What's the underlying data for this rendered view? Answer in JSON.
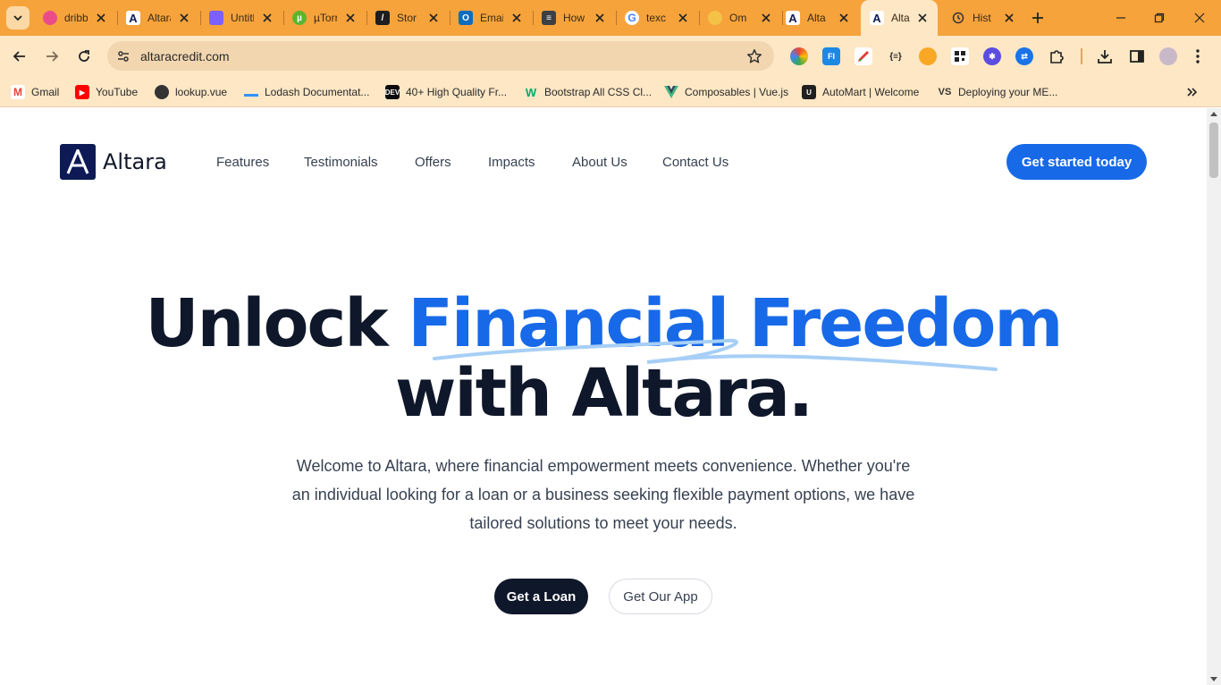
{
  "browser": {
    "tabs": [
      {
        "label": "dribbble",
        "icon": "dribbble-icon",
        "color": "#ea4c89"
      },
      {
        "label": "Altara",
        "icon": "altara-icon",
        "color": "#0d1a56"
      },
      {
        "label": "Untitled",
        "icon": "calendar-icon",
        "color": "#7b61ff"
      },
      {
        "label": "µTorrent",
        "icon": "utorrent-icon",
        "color": "#5eb42c"
      },
      {
        "label": "Stor",
        "icon": "storybook-icon",
        "color": "#1e1e1e"
      },
      {
        "label": "Email",
        "icon": "outlook-icon",
        "color": "#0f6cbd"
      },
      {
        "label": "How",
        "icon": "doc-icon",
        "color": "#3c4043"
      },
      {
        "label": "texc",
        "icon": "google-icon",
        "color": "#4285f4"
      },
      {
        "label": "Om",
        "icon": "om-icon",
        "color": "#f3c246"
      },
      {
        "label": "Alta",
        "icon": "altara-icon",
        "color": "#0d1a56"
      },
      {
        "label": "Alta",
        "icon": "altara-icon",
        "color": "#0d1a56"
      },
      {
        "label": "Hist",
        "icon": "history-icon",
        "color": "#3c3c3c"
      }
    ],
    "url": "altaracredit.com",
    "bookmarks": [
      {
        "label": "Gmail",
        "icon": "gmail-icon",
        "color": "#ea4335"
      },
      {
        "label": "YouTube",
        "icon": "youtube-icon",
        "color": "#ff0000"
      },
      {
        "label": "lookup.vue",
        "icon": "globe-icon",
        "color": "#333333"
      },
      {
        "label": "Lodash Documentat...",
        "icon": "lodash-icon",
        "color": "#3492ff"
      },
      {
        "label": "40+ High Quality Fr...",
        "icon": "dev-icon",
        "color": "#0a0a0a"
      },
      {
        "label": "Bootstrap All CSS Cl...",
        "icon": "w3-icon",
        "color": "#04aa6d"
      },
      {
        "label": "Composables | Vue.js",
        "icon": "vue-icon",
        "color": "#41b883"
      },
      {
        "label": "AutoMart | Welcome",
        "icon": "automart-icon",
        "color": "#1f1f1f"
      },
      {
        "label": "Deploying your ME...",
        "icon": "vs-icon",
        "color": "#333333"
      }
    ]
  },
  "site": {
    "logo_text": "Altara",
    "logo_letter": "A",
    "nav": [
      "Features",
      "Testimonials",
      "Offers",
      "Impacts",
      "About Us",
      "Contact Us"
    ],
    "cta_top": "Get started today",
    "hero": {
      "line1_plain": "Unlock ",
      "line1_accent": "Financial Freedom",
      "line2": "with Altara.",
      "description": "Welcome to Altara, where financial empowerment meets convenience. Whether you're an individual looking for a loan or a business seeking flexible payment options, we have tailored solutions to meet your needs.",
      "primary_button": "Get a Loan",
      "secondary_button": "Get Our App"
    },
    "colors": {
      "brand_navy": "#0d1a56",
      "accent_blue": "#1769e8",
      "dark": "#0f172a",
      "squiggle": "#a7cff6"
    }
  }
}
